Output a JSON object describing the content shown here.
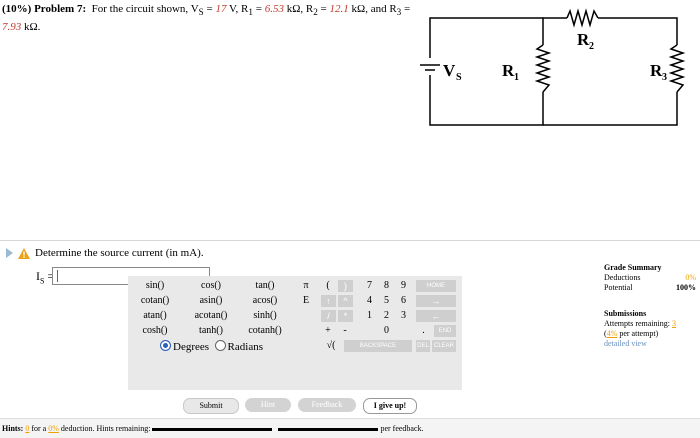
{
  "problem": {
    "prefix": "(10%) Problem 7:",
    "text_start": "For the circuit shown, V",
    "vs_sub": "S",
    "vs_eq": " = ",
    "vs_val": "17",
    "vs_unit": " V, R",
    "r1_sub": "1",
    "r1_eq": " = ",
    "r1_val": "6.53",
    "r1_unit": " kΩ, R",
    "r2_sub": "2",
    "r2_eq": " = ",
    "r2_val": "12.1",
    "r2_unit": " kΩ, and R",
    "r3_sub": "3",
    "r3_eq": " = ",
    "r3_val": "7.93",
    "r3_unit": " kΩ."
  },
  "circuit": {
    "vs_label": "V",
    "vs_sub": "S",
    "r1_label": "R",
    "r1_sub": "1",
    "r2_label": "R",
    "r2_sub": "2",
    "r3_label": "R",
    "r3_sub": "3"
  },
  "question": {
    "text": "Determine the source current (in mA).",
    "answer_label": "I",
    "answer_sub": "S",
    "answer_eq": " = ",
    "answer_value": ""
  },
  "grade": {
    "title": "Grade Summary",
    "deductions_label": "Deductions",
    "deductions_value": "0%",
    "potential_label": "Potential",
    "potential_value": "100%"
  },
  "submissions": {
    "title": "Submissions",
    "attempts_label": "Attempts remaining:",
    "attempts_value": "3",
    "per_attempt_open": "(",
    "per_attempt_pct": "4%",
    "per_attempt_text": " per attempt)",
    "detailed_view": "detailed view"
  },
  "calculator": {
    "functions": [
      [
        "sin()",
        "cos()",
        "tan()"
      ],
      [
        "cotan()",
        "asin()",
        "acos()"
      ],
      [
        "atan()",
        "acotan()",
        "sinh()"
      ],
      [
        "cosh()",
        "tanh()",
        "cotanh()"
      ]
    ],
    "pi": "π",
    "e": "E",
    "open_paren": "(",
    "close_paren": ")",
    "plus": "+",
    "minus": "-",
    "sqrt": "√(",
    "digits": [
      "7",
      "8",
      "9",
      "4",
      "5",
      "6",
      "1",
      "2",
      "3",
      "0",
      "."
    ],
    "home": "HOME",
    "end": "END",
    "backspace": "BACKSPACE",
    "del": "DEL",
    "clear": "CLEAR",
    "degrees": "Degrees",
    "radians": "Radians"
  },
  "buttons": {
    "submit": "Submit",
    "hint": "Hint",
    "feedback": "Feedback",
    "give_up": "I give up!"
  },
  "hints": {
    "label": "Hints:",
    "count": "0",
    "for_a": " for a ",
    "pct": "0%",
    "deduction": " deduction. Hints remaining:",
    "feedback_tail": "per feedback."
  },
  "colors": {
    "accent_red": "#c0392b",
    "orange": "#f0a000",
    "link_blue": "#1a4fb3"
  }
}
